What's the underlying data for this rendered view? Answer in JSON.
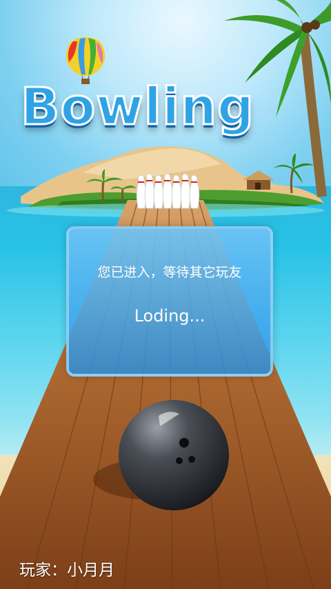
{
  "game": {
    "title": "Bowling",
    "status_message": "您已进入，等待其它玩友",
    "loading_text": "Loding...",
    "player_label": "玩家：小月月"
  },
  "colors": {
    "title_fill": "#2fa3e6",
    "title_shadow": "#1565a8",
    "dialog_top": "#6ec3f5",
    "dialog_bottom": "#2391e6",
    "lane_wood": "#9a5523",
    "ball": "#3a3d42",
    "sea": "#27c2e6"
  },
  "icons": [
    "hot-air-balloon-icon",
    "palm-tree-icon",
    "bowling-pin-icon",
    "bowling-ball-icon",
    "hut-icon"
  ]
}
